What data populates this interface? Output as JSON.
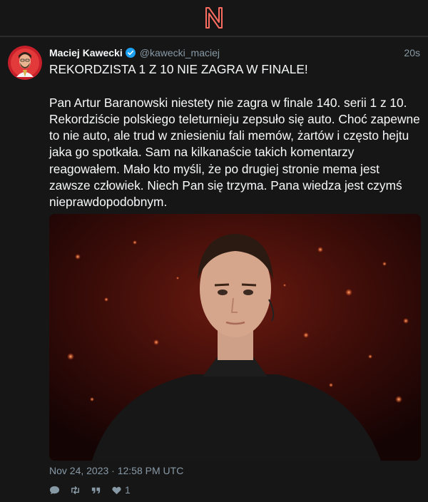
{
  "app": {
    "logo_text": "N"
  },
  "tweet": {
    "fullname": "Maciej Kawecki",
    "username": "@kawecki_maciej",
    "time": "20s",
    "content": "REKORDZISTA 1 Z 10 NIE ZAGRA W FINALE!\n\nPan Artur Baranowski niestety nie zagra w finale 140. serii 1 z 10. Rekordziście polskiego teleturnieju zepsuło się auto. Choć zapewne to nie auto, ale trud w zniesieniu fali memów, żartów i często hejtu jaka go spotkała. Sam na kilkanaście takich komentarzy reagowałem. Mało kto myśli, że po drugiej stronie mema jest zawsze człowiek. Niech Pan się trzyma. Pana wiedza jest czymś nieprawdopodobnym.",
    "date": "Nov 24, 2023 · 12:58 PM UTC",
    "stats": {
      "replies": "",
      "retweets": "",
      "quotes": "",
      "likes": "1"
    },
    "icons": [
      "comment-icon",
      "retweet-icon",
      "quote-icon",
      "heart-icon",
      "verified-badge-icon"
    ]
  },
  "colors": {
    "accent": "#e0245e",
    "verified": "#1da1f2",
    "muted": "#8899a6"
  }
}
